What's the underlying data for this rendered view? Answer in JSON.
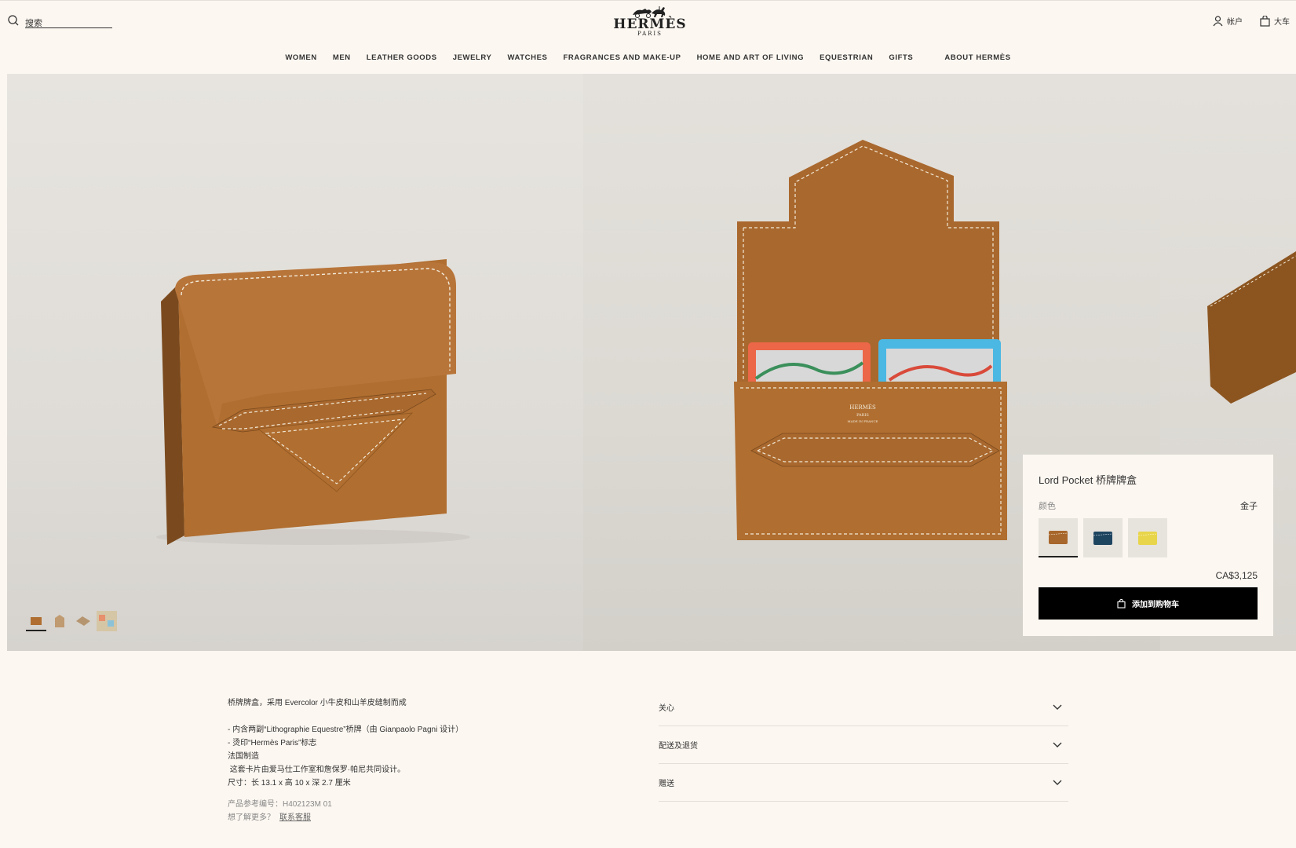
{
  "header": {
    "search_placeholder": "搜索",
    "logo_name": "HERMÈS",
    "logo_sub": "PARIS",
    "account_label": "帐户",
    "cart_label": "大车"
  },
  "nav": {
    "items": [
      "WOMEN",
      "MEN",
      "LEATHER GOODS",
      "JEWELRY",
      "WATCHES",
      "FRAGRANCES AND MAKE-UP",
      "HOME AND ART OF LIVING",
      "EQUESTRIAN",
      "GIFTS"
    ],
    "about": "ABOUT HERMÈS"
  },
  "colors": {
    "leather": "#b3722f",
    "leather_dark": "#8c5520",
    "stitch": "#f2ead8",
    "card_red": "#ec6648",
    "card_blue": "#4ab8e3"
  },
  "product": {
    "title": "Lord Pocket 桥牌牌盒",
    "color_label": "颜色",
    "color_value": "金子",
    "swatches": [
      {
        "name": "gold",
        "color": "#a8672c"
      },
      {
        "name": "navy",
        "color": "#1e4560"
      },
      {
        "name": "yellow",
        "color": "#e8d54a"
      }
    ],
    "price": "CA$3,125",
    "add_to_cart": "添加到购物车"
  },
  "description": {
    "line1": "桥牌牌盒，采用 Evercolor 小牛皮和山羊皮缝制而成",
    "line2": "- 内含两副“Lithographie Equestre”桥牌（由 Gianpaolo Pagni 设计）",
    "line3": "- 烫印“Hermès Paris”标志",
    "line4": "法国制造",
    "line5": " 这套卡片由爱马仕工作室和詹保罗·帕尼共同设计。",
    "line6": "尺寸：长 13.1 x 高 10 x 深 2.7 厘米",
    "ref": "产品参考编号：H402123M 01",
    "help": "想了解更多？",
    "contact": "联系客服"
  },
  "accordion": [
    "关心",
    "配送及退货",
    "赠送"
  ]
}
